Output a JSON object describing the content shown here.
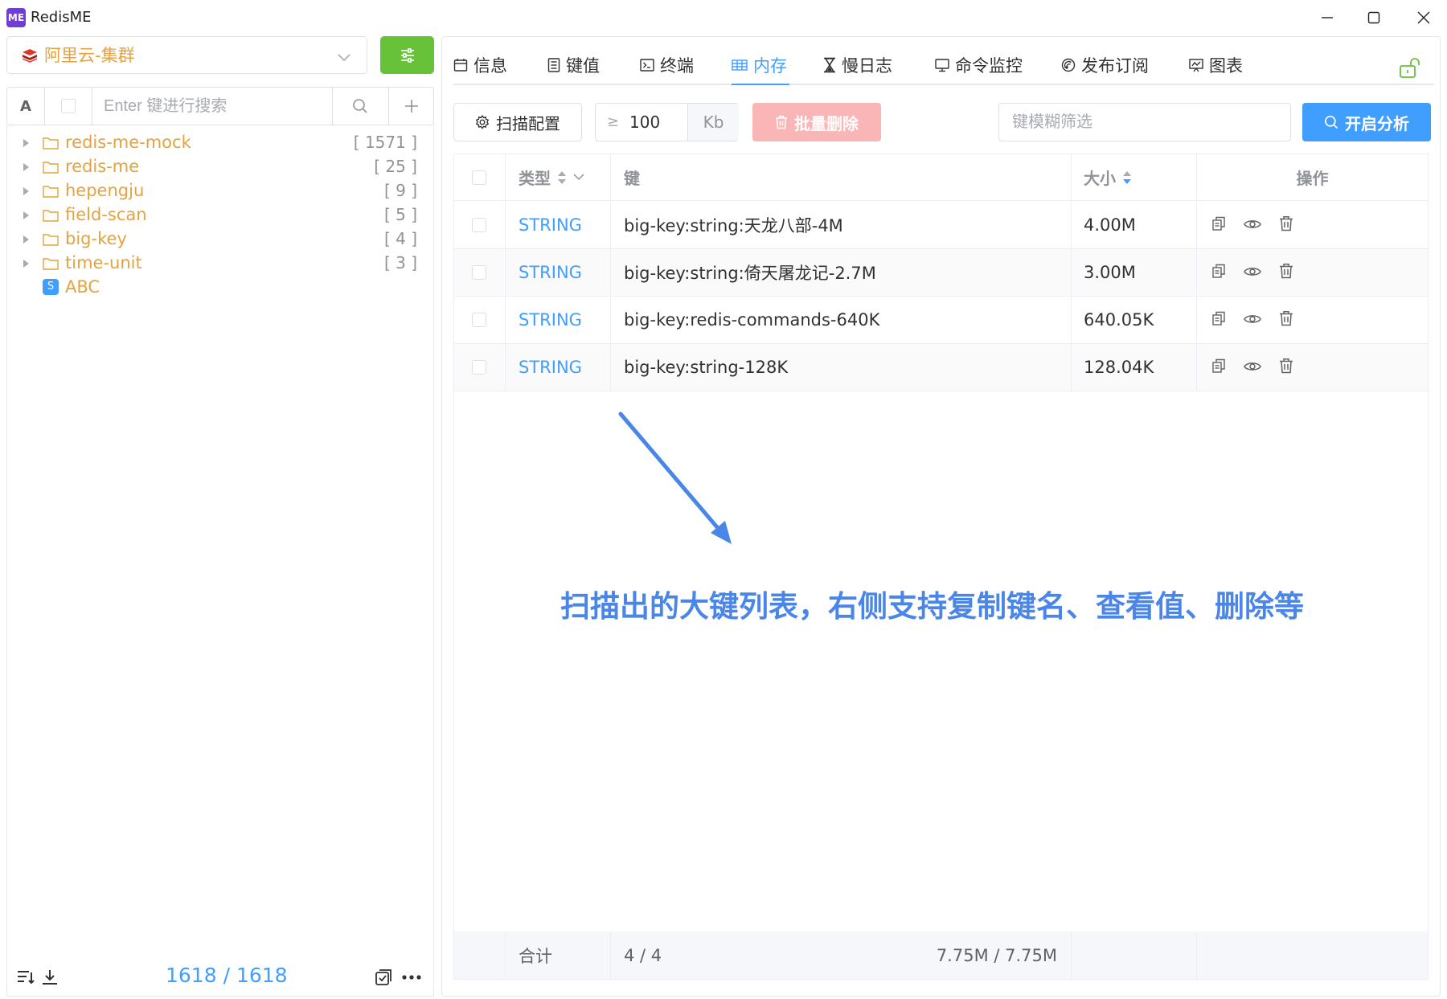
{
  "app": {
    "logo_text": "ME",
    "title": "RedisME"
  },
  "connection": {
    "name": "阿里云-集群"
  },
  "search": {
    "case_label": "A",
    "placeholder": "Enter 键进行搜索"
  },
  "tree": [
    {
      "label": "redis-me-mock",
      "count": "[ 1571 ]"
    },
    {
      "label": "redis-me",
      "count": "[ 25 ]"
    },
    {
      "label": "hepengju",
      "count": "[ 9 ]"
    },
    {
      "label": "field-scan",
      "count": "[ 5 ]"
    },
    {
      "label": "big-key",
      "count": "[ 4 ]"
    },
    {
      "label": "time-unit",
      "count": "[ 3 ]"
    }
  ],
  "tree_key": {
    "badge": "S",
    "label": "ABC"
  },
  "sidebar_footer": {
    "count": "1618 / 1618"
  },
  "tabs": [
    {
      "label": "信息",
      "icon": "calendar-icon"
    },
    {
      "label": "键值",
      "icon": "document-icon"
    },
    {
      "label": "终端",
      "icon": "terminal-icon"
    },
    {
      "label": "内存",
      "icon": "table-icon",
      "active": true
    },
    {
      "label": "慢日志",
      "icon": "hourglass-icon"
    },
    {
      "label": "命令监控",
      "icon": "monitor-icon"
    },
    {
      "label": "发布订阅",
      "icon": "broadcast-icon"
    },
    {
      "label": "图表",
      "icon": "chart-icon"
    }
  ],
  "toolbar": {
    "scan_config": "扫描配置",
    "size_prefix": "≥",
    "size_value": "100",
    "size_unit": "Kb",
    "batch_delete": "批量删除",
    "filter_placeholder": "键模糊筛选",
    "start_analysis": "开启分析"
  },
  "table": {
    "headers": {
      "type": "类型",
      "key": "键",
      "size": "大小",
      "ops": "操作"
    },
    "rows": [
      {
        "type": "STRING",
        "key": "big-key:string:天龙八部-4M",
        "size": "4.00M"
      },
      {
        "type": "STRING",
        "key": "big-key:string:倚天屠龙记-2.7M",
        "size": "3.00M"
      },
      {
        "type": "STRING",
        "key": "big-key:redis-commands-640K",
        "size": "640.05K"
      },
      {
        "type": "STRING",
        "key": "big-key:string-128K",
        "size": "128.04K"
      }
    ],
    "footer": {
      "label": "合计",
      "count": "4 / 4",
      "size": "7.75M / 7.75M"
    }
  },
  "annotation": "扫描出的大键列表，右侧支持复制键名、查看值、删除等",
  "colors": {
    "accent": "#409eff",
    "folder": "#e6a23c",
    "success": "#67c23a",
    "danger_light": "#fab6b6",
    "annotation": "#4a86e8"
  }
}
